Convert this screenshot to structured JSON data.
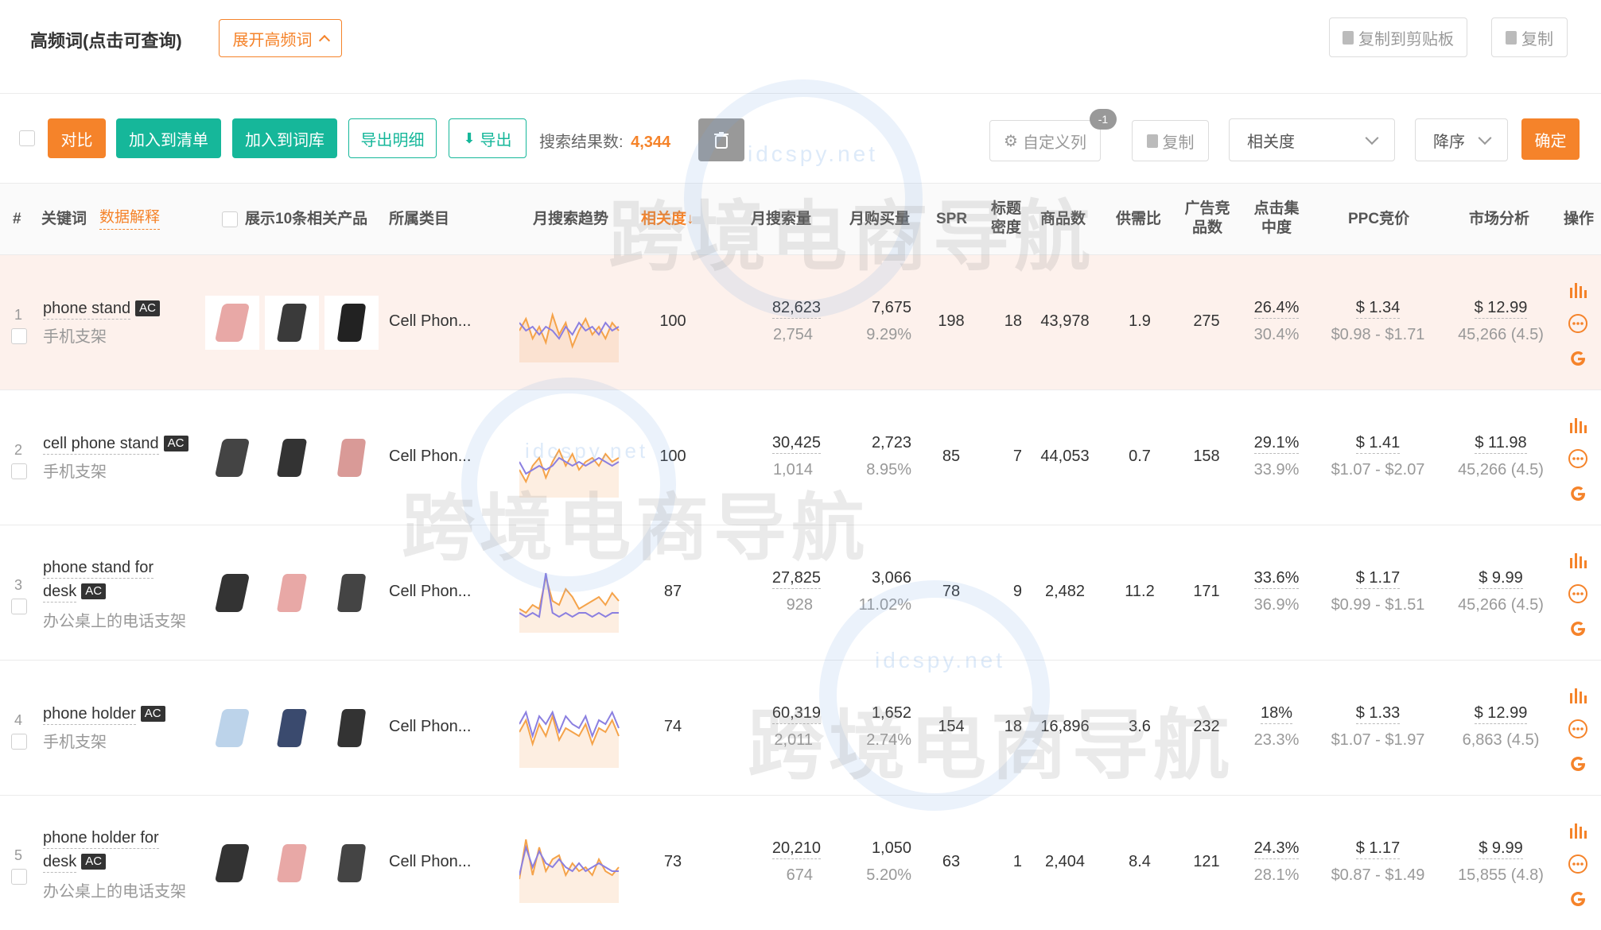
{
  "header": {
    "title": "高频词(点击可查询)",
    "expand_label": "展开高频词",
    "copy_clipboard_label": "复制到剪贴板",
    "copy_label": "复制"
  },
  "toolbar": {
    "compare_label": "对比",
    "add_list_label": "加入到清单",
    "add_lexicon_label": "加入到词库",
    "export_detail_label": "导出明细",
    "export_label": "导出",
    "result_count_label": "搜索结果数:",
    "result_count": "4,344",
    "custom_columns_label": "自定义列",
    "custom_badge": "-1",
    "copy_label": "复制",
    "sort_field": "相关度",
    "sort_order": "降序",
    "confirm_label": "确定"
  },
  "table": {
    "headers": {
      "index": "#",
      "keyword": "关键词",
      "data_explain": "数据解释",
      "show10": "展示10条相关产品",
      "category": "所属类目",
      "trend": "月搜索趋势",
      "relevance": "相关度",
      "monthly_search": "月搜索量",
      "monthly_purchase": "月购买量",
      "spr": "SPR",
      "title_density": "标题密度",
      "product_count": "商品数",
      "supply_demand": "供需比",
      "ad_competitors": "广告竞品数",
      "click_concentration": "点击集中度",
      "ppc": "PPC竞价",
      "market": "市场分析",
      "ops": "操作"
    },
    "rows": [
      {
        "index": "1",
        "keyword_l1": "phone stand",
        "keyword_l2": "",
        "zh": "手机支架",
        "category": "Cell Phon...",
        "relevance": "100",
        "search": "82,623",
        "search_sub": "2,754",
        "purchase": "7,675",
        "purchase_pct": "9.29%",
        "spr": "198",
        "density": "18",
        "products": "43,978",
        "ratio": "1.9",
        "ads": "275",
        "click1": "26.4%",
        "click2": "30.4%",
        "ppc": "$ 1.34",
        "ppc_range": "$0.98 - $1.71",
        "market": "$ 12.99",
        "market_sub": "45,266 (4.5)"
      },
      {
        "index": "2",
        "keyword_l1": "cell phone stand",
        "keyword_l2": "",
        "zh": "手机支架",
        "category": "Cell Phon...",
        "relevance": "100",
        "search": "30,425",
        "search_sub": "1,014",
        "purchase": "2,723",
        "purchase_pct": "8.95%",
        "spr": "85",
        "density": "7",
        "products": "44,053",
        "ratio": "0.7",
        "ads": "158",
        "click1": "29.1%",
        "click2": "33.9%",
        "ppc": "$ 1.41",
        "ppc_range": "$1.07 - $2.07",
        "market": "$ 11.98",
        "market_sub": "45,266 (4.5)"
      },
      {
        "index": "3",
        "keyword_l1": "phone stand for",
        "keyword_l2": "desk",
        "zh": "办公桌上的电话支架",
        "category": "Cell Phon...",
        "relevance": "87",
        "search": "27,825",
        "search_sub": "928",
        "purchase": "3,066",
        "purchase_pct": "11.02%",
        "spr": "78",
        "density": "9",
        "products": "2,482",
        "ratio": "11.2",
        "ads": "171",
        "click1": "33.6%",
        "click2": "36.9%",
        "ppc": "$ 1.17",
        "ppc_range": "$0.99 - $1.51",
        "market": "$ 9.99",
        "market_sub": "45,266 (4.5)"
      },
      {
        "index": "4",
        "keyword_l1": "phone holder",
        "keyword_l2": "",
        "zh": "手机支架",
        "category": "Cell Phon...",
        "relevance": "74",
        "search": "60,319",
        "search_sub": "2,011",
        "purchase": "1,652",
        "purchase_pct": "2.74%",
        "spr": "154",
        "density": "18",
        "products": "16,896",
        "ratio": "3.6",
        "ads": "232",
        "click1": "18%",
        "click2": "23.3%",
        "ppc": "$ 1.33",
        "ppc_range": "$1.07 - $1.97",
        "market": "$ 12.99",
        "market_sub": "6,863 (4.5)"
      },
      {
        "index": "5",
        "keyword_l1": "phone holder for",
        "keyword_l2": "desk",
        "zh": "办公桌上的电话支架",
        "category": "Cell Phon...",
        "relevance": "73",
        "search": "20,210",
        "search_sub": "674",
        "purchase": "1,050",
        "purchase_pct": "5.20%",
        "spr": "63",
        "density": "1",
        "products": "2,404",
        "ratio": "8.4",
        "ads": "121",
        "click1": "24.3%",
        "click2": "28.1%",
        "ppc": "$ 1.17",
        "ppc_range": "$0.87 - $1.49",
        "market": "$ 9.99",
        "market_sub": "15,855 (4.8)"
      }
    ]
  },
  "ac_label": "AC",
  "watermark": {
    "text": "跨境电商导航",
    "url": "idcspy.net"
  },
  "colors": {
    "accent": "#f5832a",
    "green": "#16b79a",
    "highlight_row": "#fdf1ec"
  }
}
